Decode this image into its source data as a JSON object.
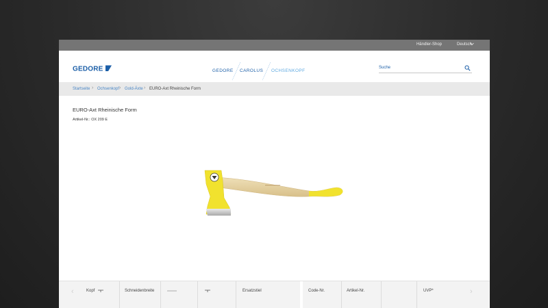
{
  "topbar": {
    "dealer_shop": "Händler-Shop",
    "language": "Deutsch"
  },
  "header": {
    "logo": "GEDORE",
    "brands": [
      "GEDORE",
      "CAROLUS",
      "OCHSENKOPF"
    ],
    "search_placeholder": "Suche"
  },
  "breadcrumb": [
    "Startseite",
    "Ochsenkopf",
    "Gold-Äxte",
    "EURO-Axt Rheinische Form"
  ],
  "product": {
    "title": "EURO-Axt Rheinische Form",
    "article_no": "Artikel-Nr.: OX 209 E"
  },
  "table": {
    "columns": [
      "Kopf",
      "Schneidenbreite",
      "",
      "",
      "Ersatzstiel",
      "Code-Nr.",
      "Artikel-Nr.",
      "UVP*"
    ],
    "prev_icon": "chevron-left-icon",
    "next_icon": "chevron-right-icon"
  },
  "colors": {
    "topbar": "#757575",
    "link": "#1c5fa8",
    "breadcrumb_link": "#4a86c5",
    "brand_carolus": "#1c5fa8",
    "brand_ochsenkopf": "#5da8e0",
    "axe_yellow": "#f1e22e",
    "handle_wood": "#e6d2a4"
  }
}
